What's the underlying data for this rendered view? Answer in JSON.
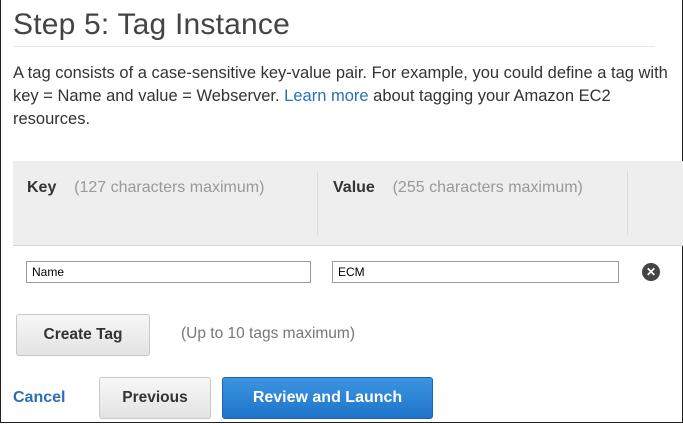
{
  "step": {
    "title": "Step 5: Tag Instance",
    "description_before_link": "A tag consists of a case-sensitive key-value pair. For example, you could define a tag with key = Name and value = Webserver. ",
    "learn_more_link": "Learn more",
    "description_after_link": " about tagging your Amazon EC2 resources."
  },
  "table": {
    "key_header": "Key",
    "key_hint": "(127 characters maximum)",
    "value_header": "Value",
    "value_hint": "(255 characters maximum)",
    "rows": [
      {
        "key": "Name",
        "value": "ECM"
      }
    ],
    "remove_icon": "close-circle-icon"
  },
  "actions": {
    "create_tag_label": "Create Tag",
    "limit_note": "(Up to 10 tags maximum)",
    "cancel_label": "Cancel",
    "previous_label": "Previous",
    "review_launch_label": "Review and Launch"
  },
  "colors": {
    "link": "#2a6fb8",
    "primary_button": "#2a82d6"
  }
}
